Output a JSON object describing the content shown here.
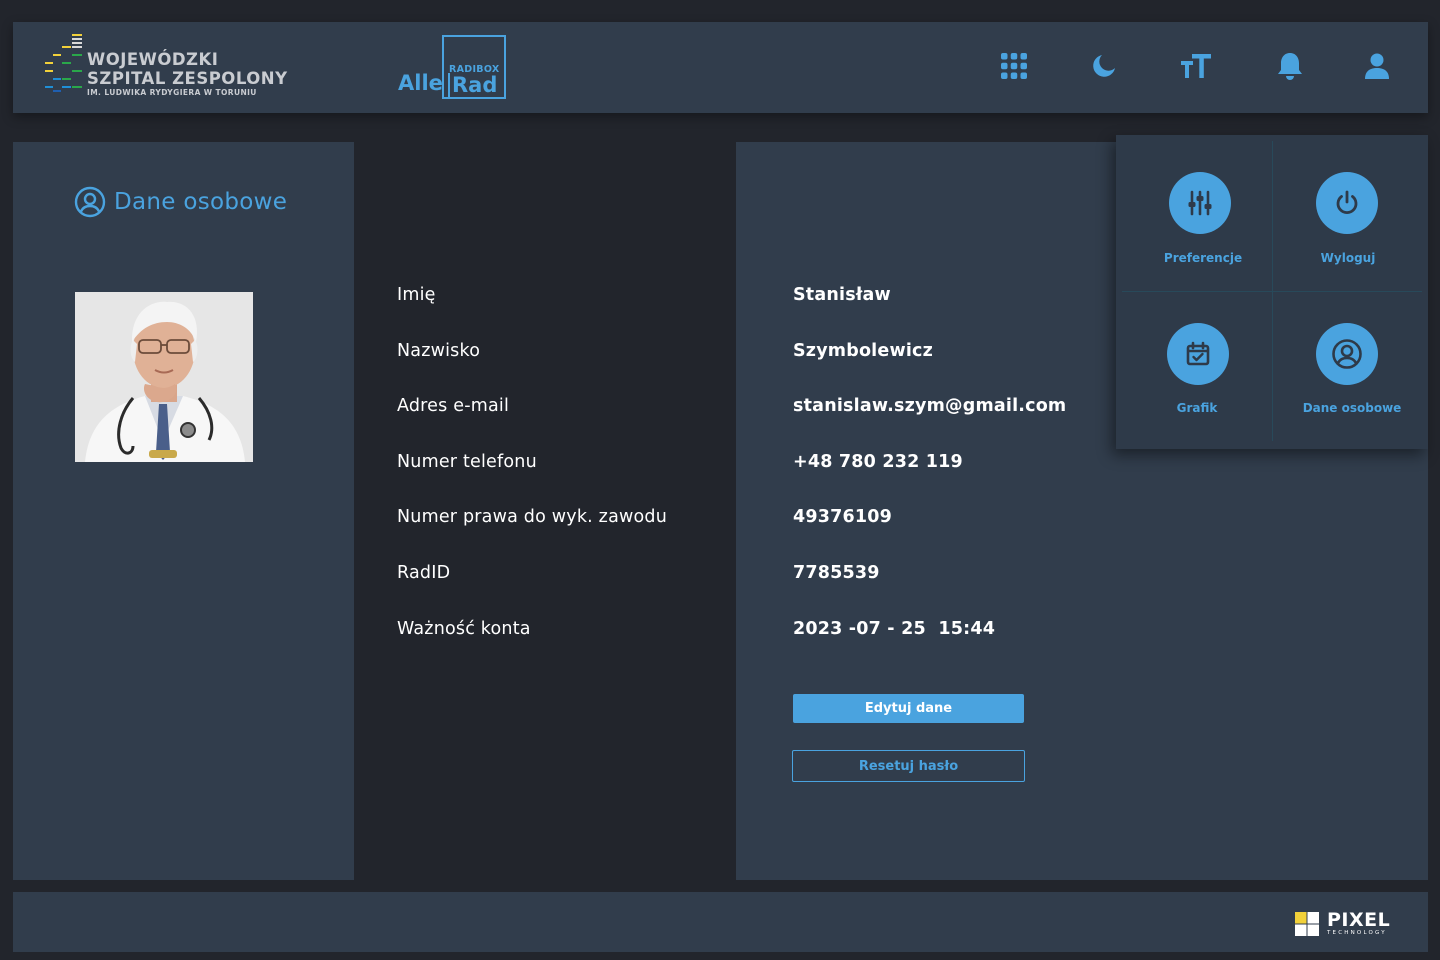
{
  "header": {
    "hospital": {
      "line1": "WOJEWÓDZKI",
      "line2": "SZPITAL ZESPOLONY",
      "line3": "IM. LUDWIKA RYDYGIERA W TORUNIU"
    },
    "brand": {
      "alle": "Alle",
      "radibox": "RADIBOX",
      "rad": "Rad"
    },
    "icons": [
      "apps-grid-icon",
      "dark-mode-moon-icon",
      "font-size-icon",
      "notifications-bell-icon",
      "user-account-icon"
    ]
  },
  "section": {
    "title": "Dane osobowe"
  },
  "profile": {
    "fields": [
      {
        "label": "Imię",
        "value": "Stanisław"
      },
      {
        "label": "Nazwisko",
        "value": "Szymbolewicz"
      },
      {
        "label": "Adres e-mail",
        "value": "stanislaw.szym@gmail.com"
      },
      {
        "label": "Numer telefonu",
        "value": "+48 780 232 119"
      },
      {
        "label": "Numer prawa do wyk. zawodu",
        "value": "49376109"
      },
      {
        "label": "RadID",
        "value": "7785539"
      },
      {
        "label": "Ważność konta",
        "value": "2023 -07 - 25  15:44"
      }
    ]
  },
  "actions": {
    "edit": "Edytuj dane",
    "reset": "Resetuj hasło"
  },
  "menu": {
    "items": [
      {
        "label": "Preferencje",
        "icon": "sliders-icon"
      },
      {
        "label": "Wyloguj",
        "icon": "power-icon"
      },
      {
        "label": "Grafik",
        "icon": "calendar-check-icon"
      },
      {
        "label": "Dane osobowe",
        "icon": "user-circle-icon"
      }
    ]
  },
  "footer": {
    "brand": "PIXEL",
    "sub": "TECHNOLOGY"
  },
  "colors": {
    "accent": "#4aa3df",
    "panel": "#313d4c",
    "background": "#22252c"
  }
}
